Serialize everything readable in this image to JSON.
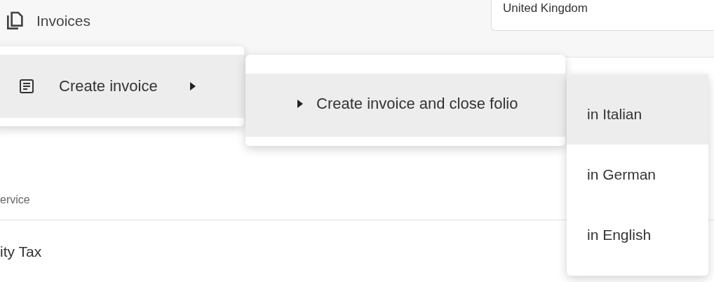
{
  "header": {
    "title": "Invoices"
  },
  "country_field": {
    "value": "United Kingdom"
  },
  "background_rows": [
    {
      "kind": "label",
      "text": "ervice"
    },
    {
      "kind": "value",
      "text": "ity Tax"
    }
  ],
  "menus": [
    {
      "items": [
        {
          "kind": "trailing-caret",
          "label": "Create invoice",
          "selected": true
        }
      ]
    },
    {
      "items": [
        {
          "kind": "leading-caret",
          "label": "Create invoice and close folio",
          "selected": true
        }
      ]
    },
    {
      "items": [
        {
          "kind": "plain",
          "label": "in Italian",
          "selected": true
        },
        {
          "kind": "plain",
          "label": "in German",
          "selected": false
        },
        {
          "kind": "plain",
          "label": "in English",
          "selected": false
        }
      ]
    }
  ]
}
